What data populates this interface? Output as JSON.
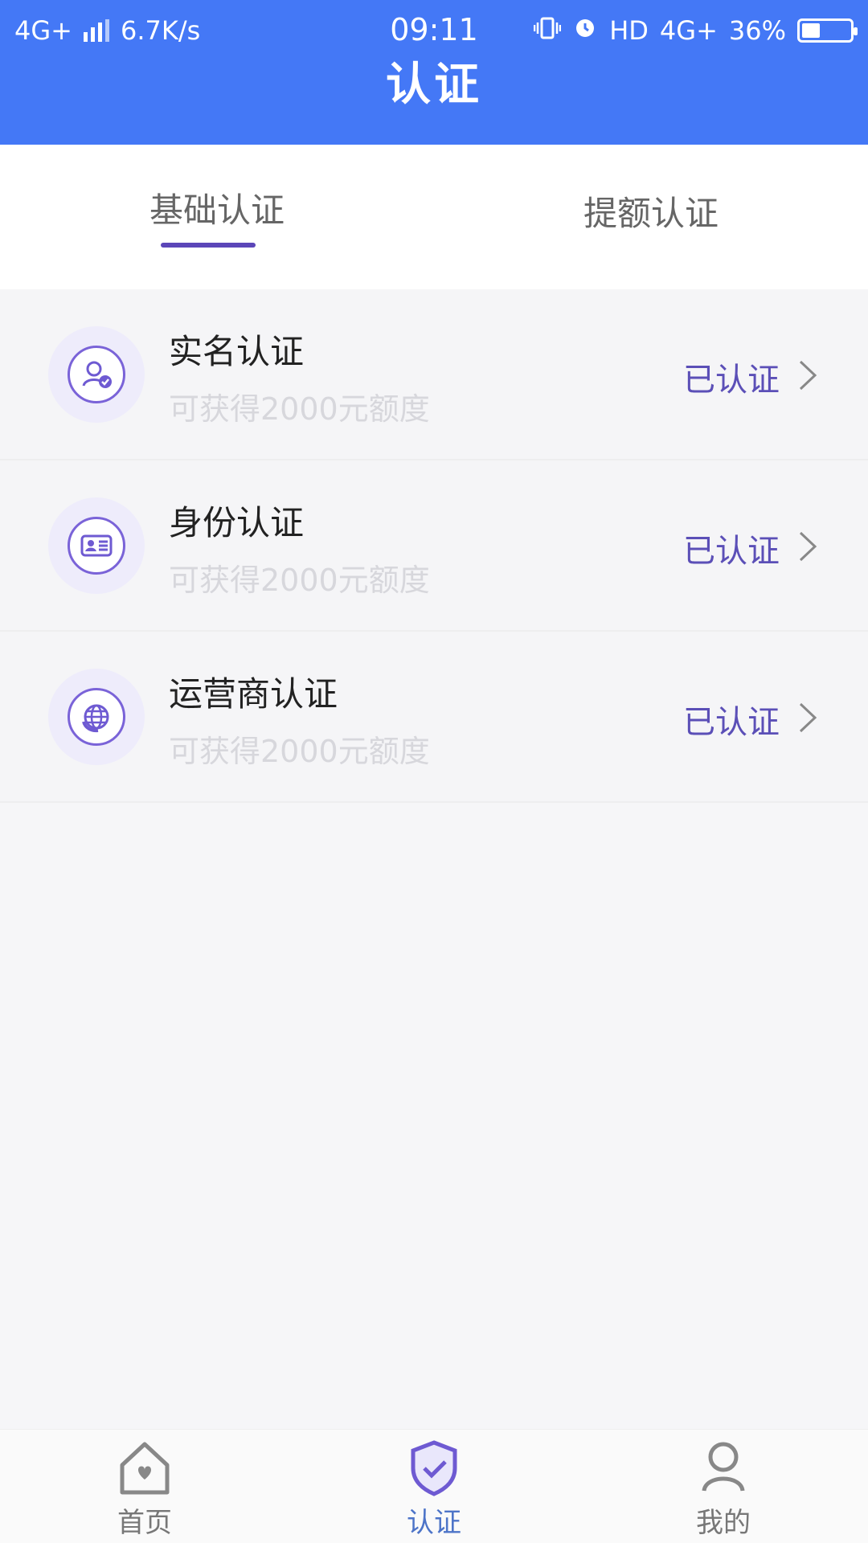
{
  "status_bar": {
    "network_left": "4G+",
    "speed": "6.7K/s",
    "time": "09:11",
    "network_right": "HD",
    "network_right_type": "4G+",
    "battery": "36%"
  },
  "header": {
    "title": "认证"
  },
  "tabs": [
    {
      "label": "基础认证",
      "active": true
    },
    {
      "label": "提额认证",
      "active": false
    }
  ],
  "items": [
    {
      "title": "实名认证",
      "subtitle": "可获得2000元额度",
      "status": "已认证",
      "icon": "user-check-icon"
    },
    {
      "title": "身份认证",
      "subtitle": "可获得2000元额度",
      "status": "已认证",
      "icon": "id-card-icon"
    },
    {
      "title": "运营商认证",
      "subtitle": "可获得2000元额度",
      "status": "已认证",
      "icon": "globe-icon"
    }
  ],
  "bottom_nav": [
    {
      "label": "首页",
      "icon": "home-icon"
    },
    {
      "label": "认证",
      "icon": "shield-check-icon",
      "active": true
    },
    {
      "label": "我的",
      "icon": "user-icon"
    }
  ],
  "colors": {
    "header": "#4478f6",
    "accent": "#5b46b8",
    "status_text": "#5b4fb7",
    "active_nav": "#4d74c8"
  }
}
